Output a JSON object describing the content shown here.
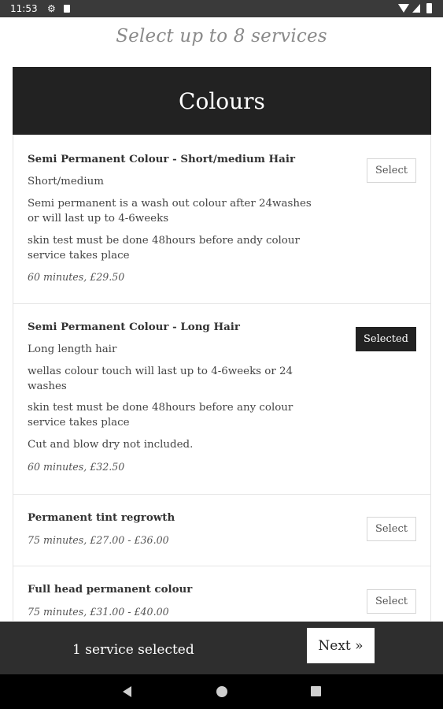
{
  "status_bar": {
    "time": "11:53",
    "icons": [
      "gear-icon",
      "sd-card-icon",
      "wifi-icon",
      "signal-icon",
      "battery-icon"
    ]
  },
  "page": {
    "heading": "Select up to 8 services"
  },
  "category": {
    "title": "Colours"
  },
  "services": [
    {
      "title": "Semi Permanent Colour - Short/medium Hair",
      "lines": [
        "Short/medium",
        "Semi permanent is a wash out colour after 24washes or will last up to 4-6weeks",
        "skin test must be done 48hours before andy colour service takes place"
      ],
      "meta": "60 minutes, £29.50",
      "button": "Select",
      "selected": false
    },
    {
      "title": "Semi Permanent Colour - Long Hair",
      "lines": [
        "Long length hair",
        "wellas colour touch will last up to 4-6weeks or 24 washes",
        "skin test must be done 48hours before any colour service takes place",
        "Cut and blow dry not included."
      ],
      "meta": "60 minutes, £32.50",
      "button": "Selected",
      "selected": true
    },
    {
      "title": "Permanent tint regrowth",
      "lines": [],
      "meta": "75 minutes, £27.00 - £36.00",
      "button": "Select",
      "selected": false
    },
    {
      "title": "Full head permanent colour",
      "lines": [],
      "meta": "75 minutes, £31.00 - £40.00",
      "button": "Select",
      "selected": false
    }
  ],
  "footer": {
    "count_text": "1 service selected",
    "next_label": "Next »"
  },
  "colors": {
    "header_bg": "#222222",
    "footer_bg": "#2e2e2e",
    "heading_text": "#8a8a8a"
  }
}
